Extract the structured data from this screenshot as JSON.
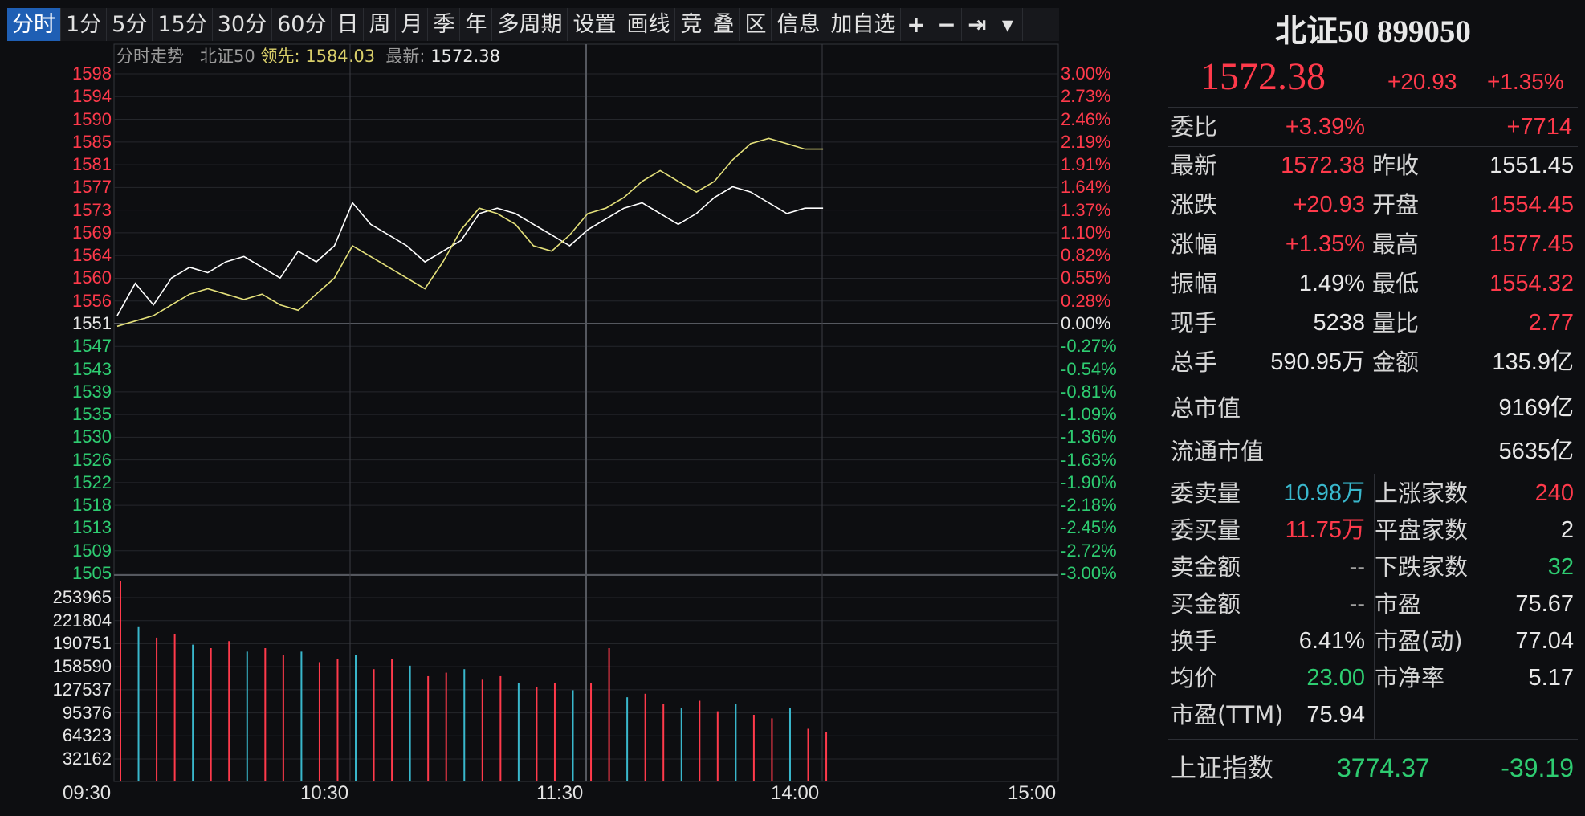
{
  "toolbar": {
    "items": [
      "分时",
      "1分",
      "5分",
      "15分",
      "30分",
      "60分",
      "日",
      "周",
      "月",
      "季",
      "年",
      "多周期",
      "设置",
      "画线",
      "竞",
      "叠",
      "区",
      "信息",
      "加自选"
    ],
    "icons": [
      "plus-icon",
      "minus-icon",
      "fullscreen-icon",
      "dropdown-icon"
    ]
  },
  "chart_header": {
    "label": "分时走势",
    "name": "北证50",
    "lead_label": "领先:",
    "lead_value": "1584.03",
    "last_label": "最新:",
    "last_value": "1572.38"
  },
  "chart_data": {
    "type": "line",
    "prev_close": 1551,
    "price_ticks": [
      "1598",
      "1594",
      "1590",
      "1585",
      "1581",
      "1577",
      "1573",
      "1569",
      "1564",
      "1560",
      "1556",
      "1551",
      "1547",
      "1543",
      "1539",
      "1535",
      "1530",
      "1526",
      "1522",
      "1518",
      "1513",
      "1509",
      "1505"
    ],
    "pct_ticks": [
      "3.00%",
      "2.73%",
      "2.46%",
      "2.19%",
      "1.91%",
      "1.64%",
      "1.37%",
      "1.10%",
      "0.82%",
      "0.55%",
      "0.28%",
      "0.00%",
      "-0.27%",
      "-0.54%",
      "-0.81%",
      "-1.09%",
      "-1.36%",
      "-1.63%",
      "-1.90%",
      "-2.18%",
      "-2.45%",
      "-2.72%",
      "-3.00%"
    ],
    "volume_ticks": [
      "253965",
      "221804",
      "190751",
      "158590",
      "127537",
      "95376",
      "64323",
      "32162"
    ],
    "time_ticks": [
      "09:30",
      "10:30",
      "11:30",
      "14:00",
      "15:00"
    ],
    "minutes_total": 240,
    "y_range": [
      1505,
      1598
    ],
    "volume_max": 285000,
    "series": [
      {
        "color": "#ffffff",
        "values": [
          1553,
          1559,
          1555,
          1560,
          1562,
          1561,
          1563,
          1564,
          1562,
          1560,
          1565,
          1563,
          1566,
          1574,
          1570,
          1568,
          1566,
          1563,
          1565,
          1567,
          1572,
          1573,
          1572,
          1570,
          1568,
          1566,
          1569,
          1571,
          1573,
          1574,
          1572,
          1570,
          1572,
          1575,
          1577,
          1576,
          1574,
          1572,
          1573,
          1573
        ]
      },
      {
        "color": "#e4e07a",
        "values": [
          1551,
          1552,
          1553,
          1555,
          1557,
          1558,
          1557,
          1556,
          1557,
          1555,
          1554,
          1557,
          1560,
          1566,
          1564,
          1562,
          1560,
          1558,
          1563,
          1569,
          1573,
          1572,
          1570,
          1566,
          1565,
          1568,
          1572,
          1573,
          1575,
          1578,
          1580,
          1578,
          1576,
          1578,
          1582,
          1585,
          1586,
          1585,
          1584,
          1584
        ]
      }
    ],
    "volumes": [
      285000,
      220000,
      205000,
      210000,
      195000,
      190000,
      200000,
      185000,
      190000,
      180000,
      185000,
      170000,
      175000,
      180000,
      160000,
      175000,
      165000,
      150000,
      155000,
      160000,
      145000,
      150000,
      140000,
      135000,
      140000,
      130000,
      140000,
      190000,
      120000,
      125000,
      110000,
      105000,
      115000,
      100000,
      110000,
      95000,
      90000,
      105000,
      75000,
      70000
    ]
  },
  "panel": {
    "title": "北证50 899050",
    "price": "1572.38",
    "change": "+20.93",
    "change_pct": "+1.35%",
    "weibi_label": "委比",
    "weibi_pct": "+3.39%",
    "weibi_diff": "+7714",
    "stats": [
      {
        "l": "最新",
        "v": "1572.38",
        "vc": "red",
        "l2": "昨收",
        "v2": "1551.45",
        "v2c": "white"
      },
      {
        "l": "涨跌",
        "v": "+20.93",
        "vc": "red",
        "l2": "开盘",
        "v2": "1554.45",
        "v2c": "red"
      },
      {
        "l": "涨幅",
        "v": "+1.35%",
        "vc": "red",
        "l2": "最高",
        "v2": "1577.45",
        "v2c": "red"
      },
      {
        "l": "振幅",
        "v": "1.49%",
        "vc": "white",
        "l2": "最低",
        "v2": "1554.32",
        "v2c": "red"
      },
      {
        "l": "现手",
        "v": "5238",
        "vc": "white",
        "l2": "量比",
        "v2": "2.77",
        "v2c": "red"
      },
      {
        "l": "总手",
        "v": "590.95万",
        "vc": "white",
        "l2": "金额",
        "v2": "135.9亿",
        "v2c": "white"
      }
    ],
    "cap_label": "总市值",
    "cap_value": "9169亿",
    "float_label": "流通市值",
    "float_value": "5635亿",
    "left2": [
      {
        "l": "委卖量",
        "v": "10.98万",
        "vc": "cyan"
      },
      {
        "l": "委买量",
        "v": "11.75万",
        "vc": "red"
      },
      {
        "l": "卖金额",
        "v": "--",
        "vc": "gray"
      },
      {
        "l": "买金额",
        "v": "--",
        "vc": "gray"
      },
      {
        "l": "换手",
        "v": "6.41%",
        "vc": "white"
      },
      {
        "l": "均价",
        "v": "23.00",
        "vc": "green"
      },
      {
        "l": "市盈(TTM)",
        "v": "75.94",
        "vc": "white"
      }
    ],
    "right2": [
      {
        "l": "上涨家数",
        "v": "240",
        "vc": "red"
      },
      {
        "l": "平盘家数",
        "v": "2",
        "vc": "white"
      },
      {
        "l": "下跌家数",
        "v": "32",
        "vc": "green"
      },
      {
        "l": "市盈",
        "v": "75.67",
        "vc": "white"
      },
      {
        "l": "市盈(动)",
        "v": "77.04",
        "vc": "white"
      },
      {
        "l": "市净率",
        "v": "5.17",
        "vc": "white"
      }
    ],
    "index_label": "上证指数",
    "index_value": "3774.37",
    "index_change": "-39.19"
  }
}
